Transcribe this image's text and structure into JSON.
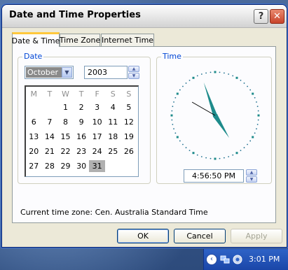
{
  "window": {
    "title": "Date and Time Properties",
    "help_label": "?",
    "close_label": "✕"
  },
  "tabs": [
    {
      "label": "Date & Time",
      "active": true
    },
    {
      "label": "Time Zone",
      "active": false
    },
    {
      "label": "Internet Time",
      "active": false
    }
  ],
  "date": {
    "group_label": "Date",
    "month": "October",
    "year": "2003",
    "weekdays": [
      "M",
      "T",
      "W",
      "T",
      "F",
      "S",
      "S"
    ],
    "weeks": [
      [
        "",
        "",
        "1",
        "2",
        "3",
        "4",
        "5"
      ],
      [
        "6",
        "7",
        "8",
        "9",
        "10",
        "11",
        "12"
      ],
      [
        "13",
        "14",
        "15",
        "16",
        "17",
        "18",
        "19"
      ],
      [
        "20",
        "21",
        "22",
        "23",
        "24",
        "25",
        "26"
      ],
      [
        "27",
        "28",
        "29",
        "30",
        "31",
        "",
        ""
      ]
    ],
    "selected_day": "31"
  },
  "time": {
    "group_label": "Time",
    "value": "4:56:50 PM",
    "hour": 4,
    "minute": 56,
    "second": 50,
    "hand_color": "#1e8b8b"
  },
  "timezone": {
    "text": "Current time zone:  Cen. Australia Standard Time"
  },
  "buttons": {
    "ok": "OK",
    "cancel": "Cancel",
    "apply": "Apply"
  },
  "taskbar": {
    "clock": "3:01 PM",
    "icons": [
      "chevron-left-icon",
      "network-icon",
      "volume-icon"
    ]
  }
}
